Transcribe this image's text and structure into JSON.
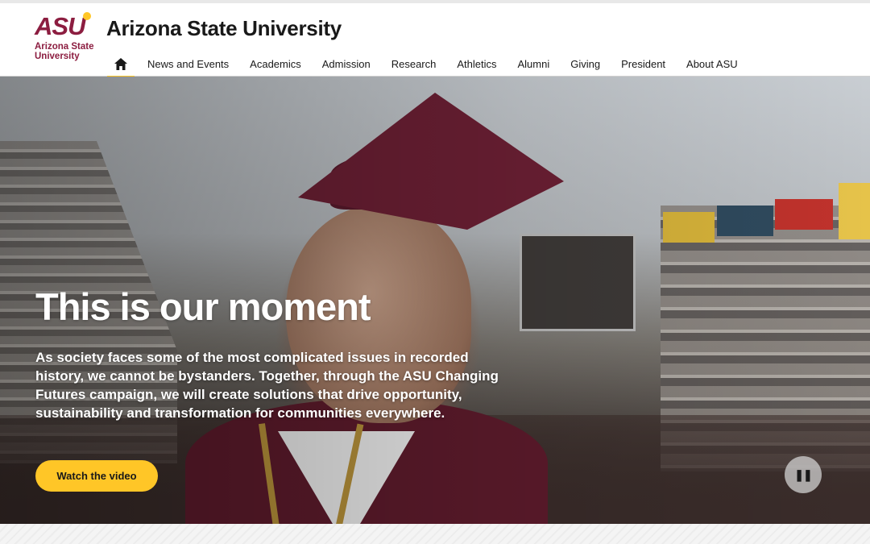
{
  "logo": {
    "mark": "ASU",
    "line1": "Arizona State",
    "line2": "University"
  },
  "site_title": "Arizona State University",
  "nav": {
    "home_icon": "home-icon",
    "items": [
      "News and Events",
      "Academics",
      "Admission",
      "Research",
      "Athletics",
      "Alumni",
      "Giving",
      "President",
      "About ASU"
    ]
  },
  "hero": {
    "title": "This is our moment",
    "text": "As society faces some of the most complicated issues in recorded history, we cannot be bystanders. Together, through the ASU Changing Futures campaign, we will create solutions that drive opportunity, sustainability and transformation for communities everywhere.",
    "cta": "Watch the video",
    "pause_icon": "pause-icon"
  },
  "colors": {
    "maroon": "#8c1d40",
    "gold": "#ffc627",
    "text": "#191919"
  }
}
